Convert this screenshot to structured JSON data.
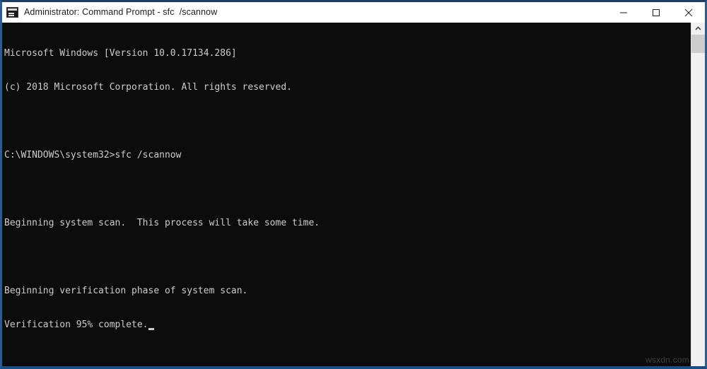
{
  "window": {
    "title": "Administrator: Command Prompt - sfc  /scannow",
    "icon": "command-prompt-icon",
    "accent_color": "#1f3d6b",
    "border_color": "#2a5c96",
    "titlebar_background": "#ffffff",
    "titlebar_text_color": "#1a1a1a",
    "controls": {
      "minimize_label": "Minimize",
      "maximize_label": "Maximize",
      "close_label": "Close"
    }
  },
  "console": {
    "background": "#0c0c0c",
    "foreground": "#cccccc",
    "lines": [
      "Microsoft Windows [Version 10.0.17134.286]",
      "(c) 2018 Microsoft Corporation. All rights reserved.",
      "",
      "C:\\WINDOWS\\system32>sfc /scannow",
      "",
      "Beginning system scan.  This process will take some time.",
      "",
      "Beginning verification phase of system scan.",
      "Verification 95% complete."
    ],
    "cursor_visible": true,
    "progress_percent": 95
  },
  "scrollbar": {
    "up_arrow": "chevron-up-icon",
    "track_color": "#f0f0f0",
    "thumb_color": "#cdcdcd"
  },
  "watermark": {
    "text": "wsxdn.com"
  }
}
